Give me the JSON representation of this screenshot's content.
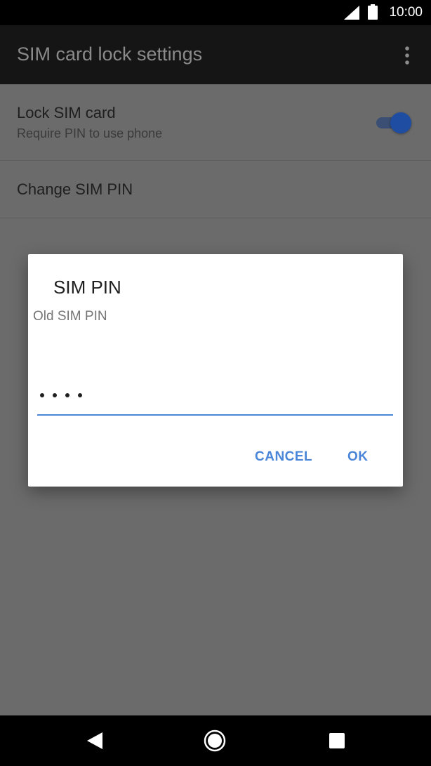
{
  "status_bar": {
    "time": "10:00",
    "signal_icon": "cellular-signal-icon",
    "battery_icon": "battery-icon"
  },
  "app_bar": {
    "title": "SIM card lock settings",
    "overflow_icon": "more-vert-icon"
  },
  "settings": {
    "lock_sim": {
      "title": "Lock SIM card",
      "subtitle": "Require PIN to use phone",
      "enabled": true
    },
    "change_pin": {
      "title": "Change SIM PIN"
    }
  },
  "dialog": {
    "title": "SIM PIN",
    "label": "Old SIM PIN",
    "pin_length": 4,
    "cancel_label": "CANCEL",
    "ok_label": "OK"
  },
  "colors": {
    "accent": "#4a86d8",
    "scrim": "#6b6b6b"
  },
  "nav_bar": {
    "back_icon": "back-triangle-icon",
    "home_icon": "home-circle-icon",
    "recents_icon": "recents-square-icon"
  }
}
